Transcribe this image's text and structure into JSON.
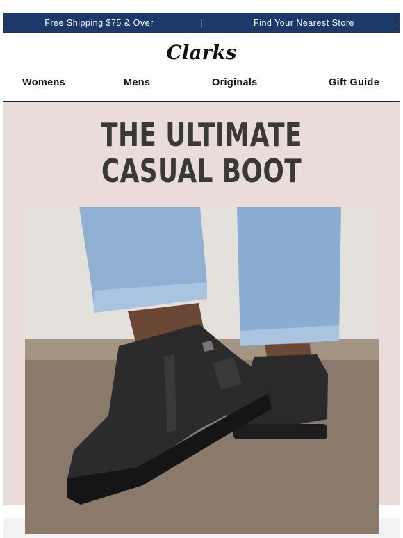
{
  "topbar": {
    "shipping": "Free Shipping $75 & Over",
    "separator": "|",
    "store_link": "Find Your Nearest Store"
  },
  "brand": {
    "logo_text": "Clarks"
  },
  "nav": {
    "items": [
      {
        "label": "Womens"
      },
      {
        "label": "Mens"
      },
      {
        "label": "Originals"
      },
      {
        "label": "Gift Guide"
      }
    ]
  },
  "hero": {
    "headline_line1": "THE ULTIMATE",
    "headline_line2": "CASUAL BOOT",
    "image_icon": "ankle-boot-photo"
  },
  "colors": {
    "topbar_bg": "#1b3a6b",
    "hero_bg": "#eadcd8",
    "headline": "#3a3a35"
  }
}
